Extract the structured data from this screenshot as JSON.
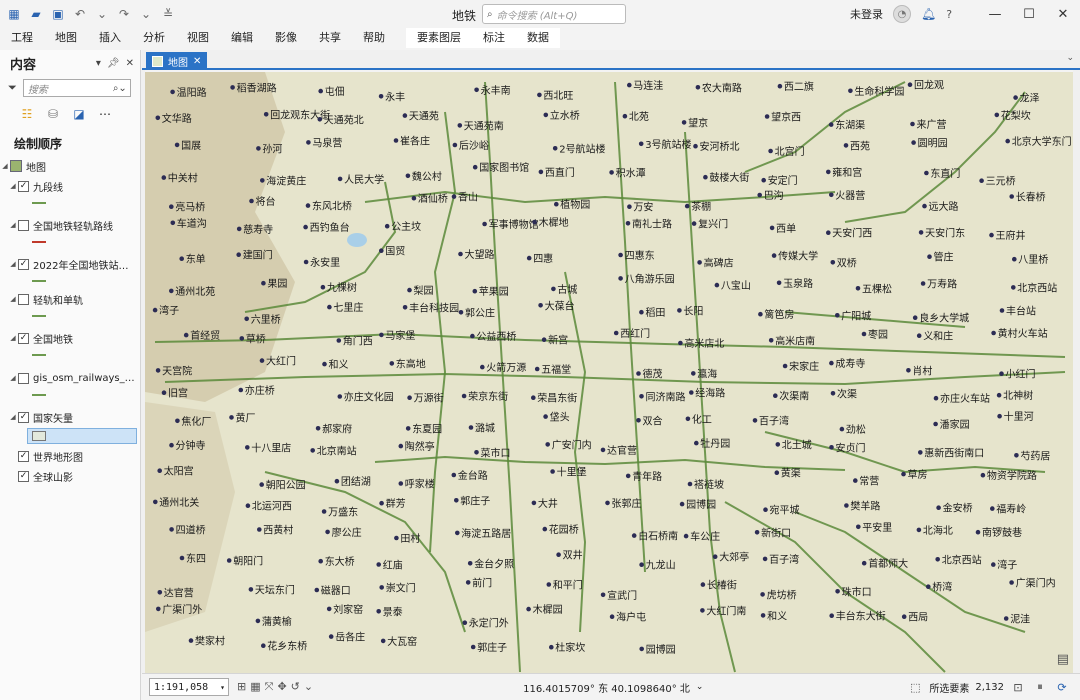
{
  "app": {
    "title": "地铁",
    "command_search_placeholder": "命令搜索 (Alt+Q)",
    "user_status": "未登录",
    "help": "?"
  },
  "ribbon": {
    "tabs": [
      "工程",
      "地图",
      "插入",
      "分析",
      "视图",
      "编辑",
      "影像",
      "共享",
      "帮助"
    ],
    "context_tabs": [
      "要素图层",
      "标注",
      "数据"
    ]
  },
  "contents": {
    "title": "内容",
    "search_placeholder": "搜索",
    "drawing_order": "绘制顺序",
    "map_node": "地图",
    "layers": [
      {
        "name": "九段线",
        "checked": true,
        "expanded": true,
        "symbol_color": "#6d9a4f"
      },
      {
        "name": "全国地铁轻轨路线",
        "checked": false,
        "expanded": true,
        "symbol_color": "#c0392b"
      },
      {
        "name": "2022年全国地铁站…",
        "checked": true,
        "expanded": true,
        "symbol_color": "#6d9a4f"
      },
      {
        "name": "轻轨和单轨",
        "checked": false,
        "expanded": true,
        "symbol_color": "#6d9a4f"
      },
      {
        "name": "全国地铁",
        "checked": true,
        "expanded": true,
        "symbol_color": "#6d9a4f"
      },
      {
        "name": "gis_osm_railways_…",
        "checked": false,
        "expanded": true,
        "symbol_color": "#6d9a4f"
      },
      {
        "name": "国家矢量",
        "checked": true,
        "expanded": true,
        "symbol_color": "#e3e9dc"
      },
      {
        "name": "世界地形图",
        "checked": true,
        "expanded": false,
        "symbol_color": ""
      },
      {
        "name": "全球山影",
        "checked": true,
        "expanded": false,
        "symbol_color": ""
      }
    ]
  },
  "map_view": {
    "tab_label": "地图",
    "colors": {
      "land": "#e6e4cc",
      "hills": "#cfc6a6",
      "line": "#5a8a3a",
      "station": "#2c2c54",
      "label": "#1a1a1a"
    },
    "labels": [
      "温阳路",
      "稻香湖路",
      "屯佃",
      "永丰",
      "永丰南",
      "西北旺",
      "马连洼",
      "农大南路",
      "西二旗",
      "生命科学园",
      "回龙观",
      "龙泽",
      "文华路",
      "回龙观东大街",
      "天通苑北",
      "天通苑",
      "天通苑南",
      "立水桥",
      "北苑",
      "望京",
      "望京西",
      "东湖渠",
      "来广营",
      "花梨坎",
      "国展",
      "孙河",
      "马泉营",
      "崔各庄",
      "后沙峪",
      "2号航站楼",
      "3号航站楼",
      "安河桥北",
      "北宫门",
      "西苑",
      "圆明园",
      "北京大学东门",
      "中关村",
      "海淀黄庄",
      "人民大学",
      "魏公村",
      "国家图书馆",
      "西直门",
      "积水潭",
      "鼓楼大街",
      "安定门",
      "雍和宫",
      "东直门",
      "三元桥",
      "亮马桥",
      "将台",
      "东风北桥",
      "酒仙桥",
      "香山",
      "植物园",
      "万安",
      "茶棚",
      "巴沟",
      "火器营",
      "远大路",
      "长春桥",
      "车道沟",
      "慈寿寺",
      "西钓鱼台",
      "公主坟",
      "军事博物馆",
      "木樨地",
      "南礼士路",
      "复兴门",
      "西单",
      "天安门西",
      "天安门东",
      "王府井",
      "东单",
      "建国门",
      "永安里",
      "国贸",
      "大望路",
      "四惠",
      "四惠东",
      "高碑店",
      "传媒大学",
      "双桥",
      "管庄",
      "八里桥",
      "通州北苑",
      "果园",
      "九棵树",
      "梨园",
      "苹果园",
      "古城",
      "八角游乐园",
      "八宝山",
      "玉泉路",
      "五棵松",
      "万寿路",
      "北京西站",
      "湾子",
      "六里桥",
      "七里庄",
      "丰台科技园",
      "郭公庄",
      "大葆台",
      "稻田",
      "长阳",
      "篱笆房",
      "广阳城",
      "良乡大学城",
      "丰台站",
      "首经贸",
      "草桥",
      "角门西",
      "马家堡",
      "公益西桥",
      "新宫",
      "西红门",
      "高米店北",
      "高米店南",
      "枣园",
      "义和庄",
      "黄村火车站",
      "天宫院",
      "大红门",
      "和义",
      "东高地",
      "火箭万源",
      "五福堂",
      "德茂",
      "瀛海",
      "宋家庄",
      "成寿寺",
      "肖村",
      "小红门",
      "旧宫",
      "亦庄桥",
      "亦庄文化园",
      "万源街",
      "荣京东街",
      "荣昌东街",
      "同济南路",
      "经海路",
      "次渠南",
      "次渠",
      "亦庄火车站",
      "北神树",
      "焦化厂",
      "黄厂",
      "郝家府",
      "东夏园",
      "潞城",
      "垡头",
      "双合",
      "化工",
      "百子湾",
      "劲松",
      "潘家园",
      "十里河",
      "分钟寺",
      "十八里店",
      "北京南站",
      "陶然亭",
      "菜市口",
      "广安门内",
      "达官营",
      "牡丹园",
      "北土城",
      "安贞门",
      "惠新西街南口",
      "芍药居",
      "太阳宫",
      "朝阳公园",
      "团结湖",
      "呼家楼",
      "金台路",
      "十里堡",
      "青年路",
      "褡裢坡",
      "黄渠",
      "常营",
      "草房",
      "物资学院路",
      "通州北关",
      "北运河西",
      "万盛东",
      "群芳",
      "郭庄子",
      "大井",
      "张郭庄",
      "园博园",
      "宛平城",
      "樊羊路",
      "金安桥",
      "福寿岭",
      "四道桥",
      "西黄村",
      "廖公庄",
      "田村",
      "海淀五路居",
      "花园桥",
      "白石桥南",
      "车公庄",
      "新街口",
      "平安里",
      "北海北",
      "南锣鼓巷",
      "东四",
      "朝阳门",
      "东大桥",
      "红庙",
      "金台夕照",
      "双井",
      "九龙山",
      "大郊亭",
      "百子湾",
      "首都师大",
      "北京西站",
      "湾子",
      "达官营",
      "天坛东门",
      "磁器口",
      "崇文门",
      "前门",
      "和平门",
      "宣武门",
      "长椿街",
      "虎坊桥",
      "珠市口",
      "桥湾",
      "广渠门内",
      "广渠门外",
      "蒲黄榆",
      "刘家窑",
      "景泰",
      "永定门外",
      "木樨园",
      "海户屯",
      "大红门南",
      "和义",
      "丰台东大街",
      "西局",
      "泥洼",
      "樊家村",
      "花乡东桥",
      "岳各庄",
      "大瓦窑",
      "郭庄子",
      "杜家坎",
      "园博园"
    ]
  },
  "statusbar": {
    "scale": "1:191,058",
    "coordinates": "116.4015709° 东 40.1098640° 北",
    "selected_features_label": "所选要素",
    "selected_features_count": "2,132"
  }
}
